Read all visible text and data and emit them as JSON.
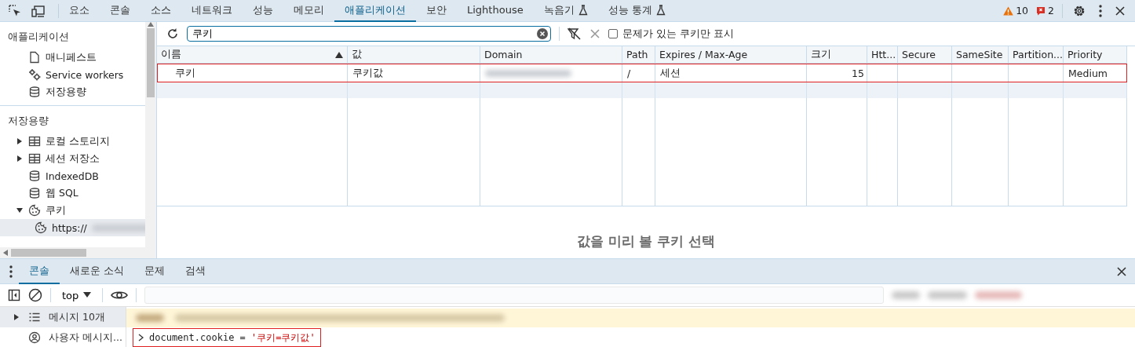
{
  "top_bar": {
    "tabs": [
      {
        "label": "요소",
        "selected": false,
        "experimental": false
      },
      {
        "label": "콘솔",
        "selected": false,
        "experimental": false
      },
      {
        "label": "소스",
        "selected": false,
        "experimental": false
      },
      {
        "label": "네트워크",
        "selected": false,
        "experimental": false
      },
      {
        "label": "성능",
        "selected": false,
        "experimental": false
      },
      {
        "label": "메모리",
        "selected": false,
        "experimental": false
      },
      {
        "label": "애플리케이션",
        "selected": true,
        "experimental": false
      },
      {
        "label": "보안",
        "selected": false,
        "experimental": false
      },
      {
        "label": "Lighthouse",
        "selected": false,
        "experimental": false
      },
      {
        "label": "녹음기",
        "selected": false,
        "experimental": true
      },
      {
        "label": "성능 통계",
        "selected": false,
        "experimental": true
      }
    ],
    "warnings": "10",
    "errors": "2"
  },
  "sidebar": {
    "sections": [
      {
        "title": "애플리케이션",
        "items": [
          {
            "label": "매니페스트",
            "kind": "file",
            "selected": false
          },
          {
            "label": "Service workers",
            "kind": "gears",
            "selected": false
          },
          {
            "label": "저장용량",
            "kind": "database",
            "selected": false
          }
        ]
      },
      {
        "title": "저장용량",
        "items": [
          {
            "label": "로컬 스토리지",
            "kind": "table",
            "expanded": false,
            "selected": false
          },
          {
            "label": "세션 저장소",
            "kind": "table",
            "expanded": false,
            "selected": false
          },
          {
            "label": "IndexedDB",
            "kind": "database",
            "selected": false
          },
          {
            "label": "웹 SQL",
            "kind": "database",
            "selected": false
          },
          {
            "label": "쿠키",
            "kind": "cookie",
            "expanded": true,
            "selected": false,
            "children": [
              {
                "label": "https://",
                "kind": "cookie",
                "selected": true,
                "redacted": true
              }
            ]
          }
        ]
      }
    ]
  },
  "cookies": {
    "search": "쿠키",
    "only_issues": {
      "label": "문제가 있는 쿠키만 표시",
      "checked": false
    },
    "columns": [
      {
        "label": "이름",
        "sorted": true
      },
      {
        "label": "값",
        "sorted": false
      },
      {
        "label": "Domain",
        "sorted": false
      },
      {
        "label": "Path",
        "sorted": false
      },
      {
        "label": "Expires / Max-Age",
        "sorted": false
      },
      {
        "label": "크기",
        "sorted": false
      },
      {
        "label": "Htt...",
        "sorted": false
      },
      {
        "label": "Secure",
        "sorted": false
      },
      {
        "label": "SameSite",
        "sorted": false
      },
      {
        "label": "Partition...",
        "sorted": false
      },
      {
        "label": "Priority",
        "sorted": false
      }
    ],
    "rows": [
      {
        "highlighted": true,
        "cells": [
          "쿠키",
          "쿠키값",
          {
            "kind": "redacted"
          },
          "/",
          "세션",
          "15",
          null,
          null,
          null,
          null,
          "Medium"
        ]
      }
    ],
    "preview_hint": "값을 미리 볼 쿠키 선택"
  },
  "drawer": {
    "tabs": [
      {
        "label": "콘솔",
        "selected": true
      },
      {
        "label": "새로운 소식",
        "selected": false
      },
      {
        "label": "문제",
        "selected": false
      },
      {
        "label": "검색",
        "selected": false
      }
    ],
    "context": "top",
    "sidebar": [
      {
        "label": "메시지 10개",
        "kind": "list",
        "expanded": false,
        "selected": true
      },
      {
        "label": "사용자 메시지...",
        "kind": "user",
        "selected": false
      }
    ],
    "command": {
      "highlighted": true,
      "code": "document.cookie = ",
      "string": "'쿠키=쿠키값'"
    }
  }
}
